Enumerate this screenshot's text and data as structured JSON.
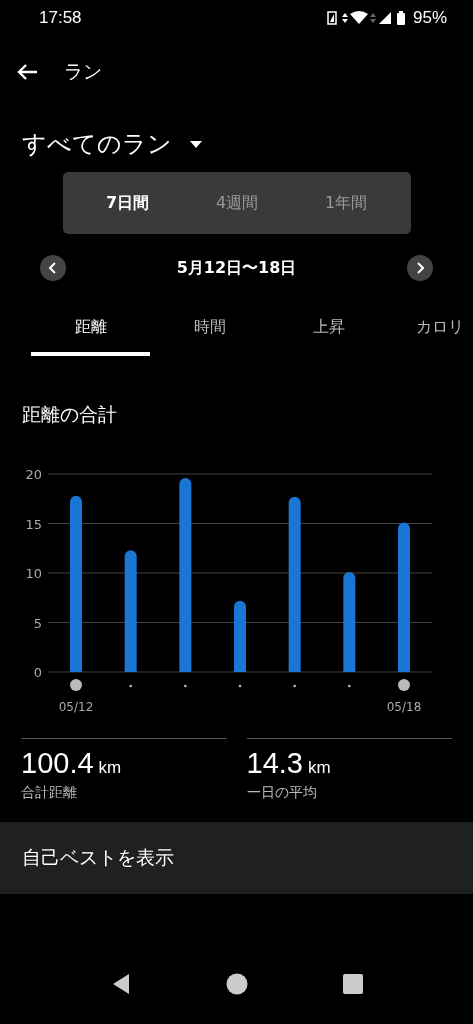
{
  "status_bar": {
    "time": "17:58",
    "battery": "95%"
  },
  "header": {
    "title": "ラン"
  },
  "filter": {
    "label": "すべてのラン"
  },
  "periods": [
    {
      "label": "7日間",
      "selected": true
    },
    {
      "label": "4週間",
      "selected": false
    },
    {
      "label": "1年間",
      "selected": false
    }
  ],
  "date_range": "5月12日〜18日",
  "tabs": [
    {
      "label": "距離",
      "selected": true
    },
    {
      "label": "時間",
      "selected": false
    },
    {
      "label": "上昇",
      "selected": false
    },
    {
      "label": "カロリ",
      "selected": false
    }
  ],
  "section_title": "距離の合計",
  "chart_data": {
    "type": "bar",
    "ylim": [
      0,
      20
    ],
    "yticks": [
      0,
      5,
      10,
      15,
      20
    ],
    "grid": true,
    "categories": [
      "05/12",
      null,
      null,
      null,
      null,
      null,
      "05/18"
    ],
    "series": [
      {
        "color": "#1976d2",
        "values": [
          17.8,
          12.3,
          19.6,
          7.2,
          17.7,
          10.1,
          15.1
        ]
      }
    ]
  },
  "stats": [
    {
      "value": "100.4",
      "unit": "km",
      "label": "合計距離"
    },
    {
      "value": "14.3",
      "unit": "km",
      "label": "一日の平均"
    }
  ],
  "best_button": "自己ベストを表示"
}
